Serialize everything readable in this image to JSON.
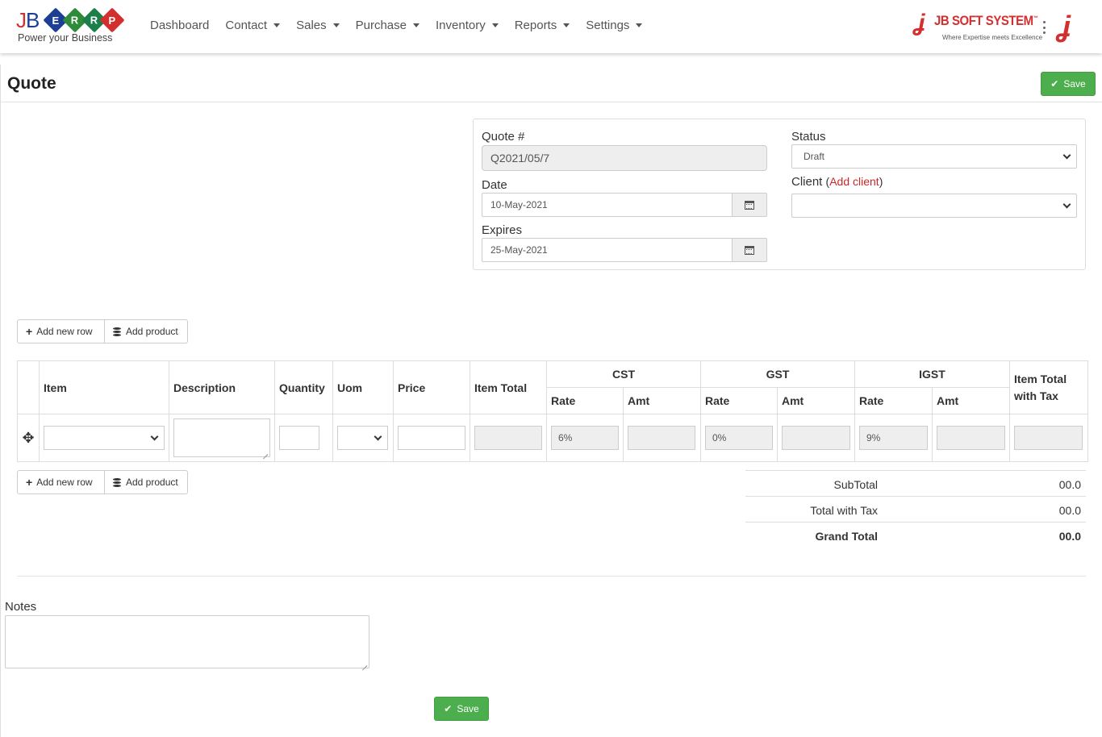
{
  "header": {
    "logo": {
      "j": "J",
      "b": "B",
      "diamonds": [
        "E",
        "R",
        "R",
        "P"
      ],
      "tagline": "Power your Business"
    },
    "nav": [
      {
        "label": "Dashboard",
        "has_caret": false
      },
      {
        "label": "Contact",
        "has_caret": true
      },
      {
        "label": "Sales",
        "has_caret": true
      },
      {
        "label": "Purchase",
        "has_caret": true
      },
      {
        "label": "Inventory",
        "has_caret": true
      },
      {
        "label": "Reports",
        "has_caret": true
      },
      {
        "label": "Settings",
        "has_caret": true
      }
    ],
    "brand_name": "JB SOFT SYSTEM",
    "brand_tm": "™",
    "brand_sub": "Where Expertise meets Excellence"
  },
  "page": {
    "title": "Quote",
    "save_label": "Save"
  },
  "meta": {
    "quote_label": "Quote #",
    "quote_value": "Q2021/05/7",
    "date_label": "Date",
    "date_value": "10-May-2021",
    "expires_label": "Expires",
    "expires_value": "25-May-2021",
    "status_label": "Status",
    "status_value": "Draft",
    "client_label": "Client",
    "client_paren_open": "(",
    "add_client_label": "Add client",
    "client_paren_close": ")",
    "client_value": ""
  },
  "actions": {
    "add_row_label": "Add new row",
    "add_product_label": "Add product"
  },
  "table": {
    "headers": {
      "item": "Item",
      "description": "Description",
      "quantity": "Quantity",
      "uom": "Uom",
      "price": "Price",
      "item_total": "Item Total",
      "cst": "CST",
      "gst": "GST",
      "igst": "IGST",
      "rate": "Rate",
      "amt": "Amt",
      "item_total_tax": "Item Total with Tax"
    },
    "row": {
      "cst_rate": "6%",
      "gst_rate": "0%",
      "igst_rate": "9%"
    }
  },
  "totals": {
    "subtotal_label": "SubTotal",
    "subtotal_value": "00.0",
    "total_tax_label": "Total with Tax",
    "total_tax_value": "00.0",
    "grand_label": "Grand Total",
    "grand_value": "00.0"
  },
  "notes": {
    "label": "Notes",
    "value": ""
  },
  "colors": {
    "brand_red": "#d32f2f",
    "save_green": "#4cae4c",
    "logo_blue": "#1c3f94"
  }
}
